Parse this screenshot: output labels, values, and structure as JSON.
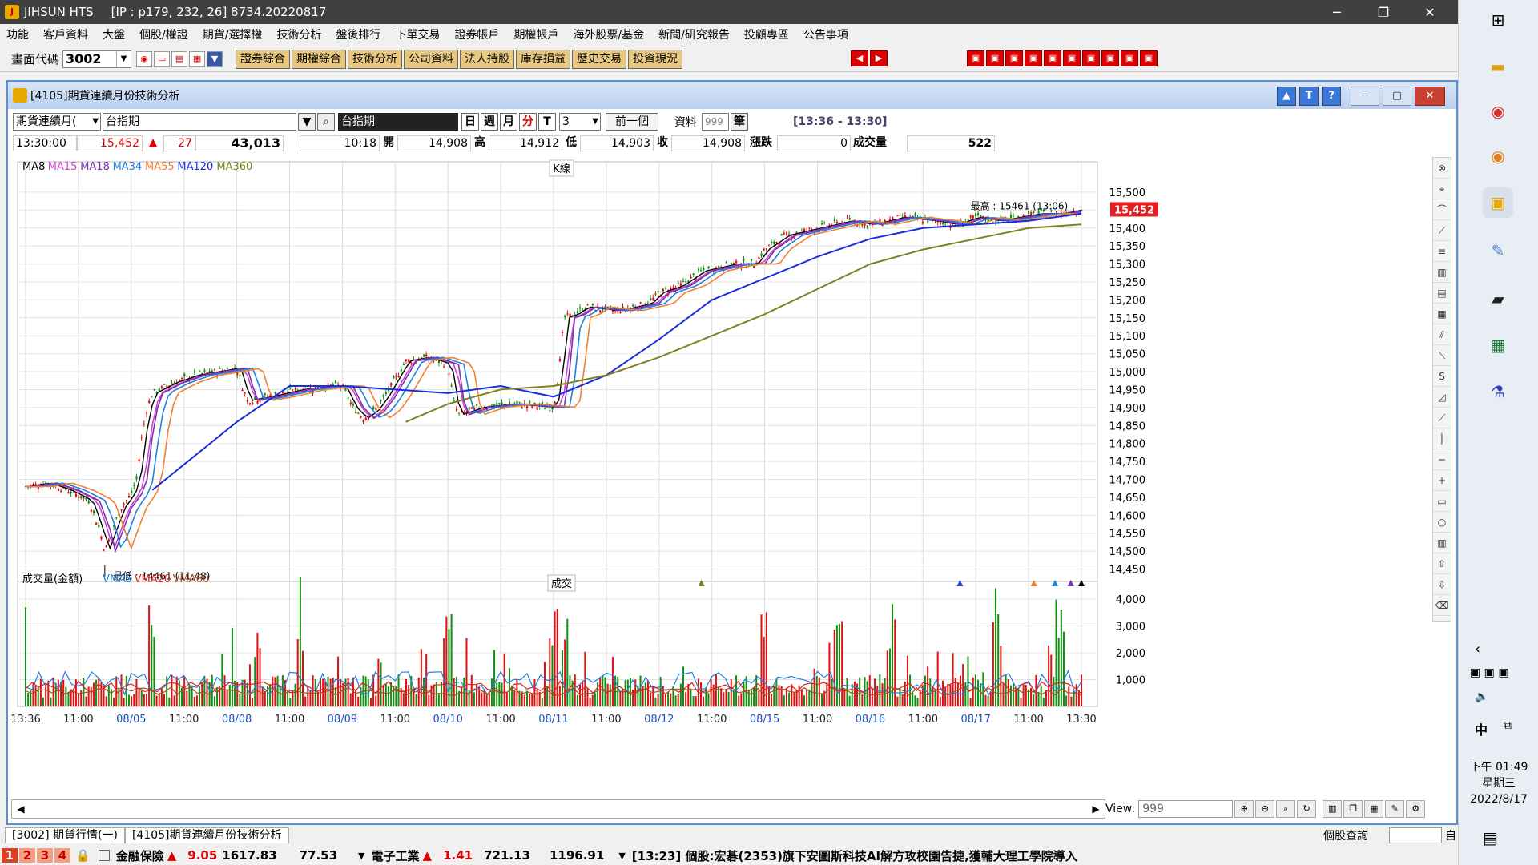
{
  "titlebar": {
    "app": "JIHSUN HTS",
    "info": "[IP : p179, 232, 26] 8734.20220817"
  },
  "menu": [
    "功能",
    "客戶資料",
    "大盤",
    "個股/權證",
    "期貨/選擇權",
    "技術分析",
    "盤後排行",
    "下單交易",
    "證券帳戶",
    "期權帳戶",
    "海外股票/基金",
    "新聞/研究報告",
    "投顧專區",
    "公告事項"
  ],
  "toolbar": {
    "code_label": "畫面代碼",
    "code_value": "3002",
    "buttons": [
      "證券綜合",
      "期權綜合",
      "技術分析",
      "公司資料",
      "法人持股",
      "庫存損益",
      "歷史交易",
      "投資現況"
    ]
  },
  "window": {
    "title": "[4105]期貨連續月份技術分析"
  },
  "controls": {
    "contract_select": "期貨連續月(",
    "index_select": "台指期",
    "name_box": "台指期",
    "periods": [
      "日",
      "週",
      "月",
      "分",
      "T"
    ],
    "minutes": "3",
    "prev_label": "前一個",
    "data_label": "資料",
    "data_value": "999",
    "unit_label": "筆",
    "time_range": "[13:36 - 13:30]"
  },
  "quote": {
    "time": "13:30:00",
    "price": "15,452",
    "change": "27",
    "volume_total": "43,013",
    "time2": "10:18",
    "open_label": "開",
    "open": "14,908",
    "high_label": "高",
    "high": "14,912",
    "low_label": "低",
    "low": "14,903",
    "close_label": "收",
    "close": "14,908",
    "chg_label": "漲跌",
    "chg": "0",
    "vol_label": "成交量",
    "vol": "522"
  },
  "legend_price": [
    {
      "name": "MA8",
      "color": "#000000"
    },
    {
      "name": "MA15",
      "color": "#cc44cc"
    },
    {
      "name": "MA18",
      "color": "#7a30b0"
    },
    {
      "name": "MA34",
      "color": "#2080e0"
    },
    {
      "name": "MA55",
      "color": "#f08030"
    },
    {
      "name": "MA120",
      "color": "#1a2ce0"
    },
    {
      "name": "MA360",
      "color": "#808020"
    }
  ],
  "kline_label": "K線",
  "legend_volume": [
    {
      "name": "成交量(金額)",
      "color": "#000000"
    },
    {
      "name": "VMA5",
      "color": "#2080e0"
    },
    {
      "name": "VMA20",
      "color": "#e02020"
    },
    {
      "name": "VMA60",
      "color": "#a05020"
    }
  ],
  "volume_label": "成交",
  "high_annot": "最高 : 15461 (13:06)",
  "low_annot": "最低 : 14461 (11:48)",
  "last_price_tag": "15,452",
  "view_label": "View:",
  "view_value": "999",
  "tabs": [
    "[3002] 期貨行情(一)",
    "[4105]期貨連續月份技術分析"
  ],
  "stock_query": "個股查詢",
  "auto_label": "自",
  "ticker": {
    "nums": [
      "1",
      "2",
      "3",
      "4"
    ],
    "sec1": "金融保險",
    "sec1_chg": "9.05",
    "sec1_val": "1617.83",
    "sec1_amt": "77.53",
    "sec2": "電子工業",
    "sec2_chg": "1.41",
    "sec2_val": "721.13",
    "sec2_amt": "1196.91",
    "news": "[13:23] 個股:宏碁(2353)旗下安圖斯科技AI解方攻校園告捷,獲輔大理工學院導入"
  },
  "clock": {
    "time": "下午 01:49",
    "day": "星期三",
    "date": "2022/8/17"
  },
  "ime": "中",
  "chart_data": [
    {
      "type": "candlestick",
      "title": "",
      "x_labels": [
        "13:36",
        "11:00",
        "08/05",
        "11:00",
        "08/08",
        "11:00",
        "08/09",
        "11:00",
        "08/10",
        "11:00",
        "08/11",
        "11:00",
        "08/12",
        "11:00",
        "08/15",
        "11:00",
        "08/16",
        "11:00",
        "08/17",
        "11:00",
        "13:30"
      ],
      "y_ticks": [
        15500,
        15450,
        15400,
        15350,
        15300,
        15250,
        15200,
        15150,
        15100,
        15050,
        15000,
        14950,
        14900,
        14850,
        14800,
        14750,
        14700,
        14650,
        14600,
        14550,
        14500,
        14450
      ],
      "ylim": [
        14420,
        15540
      ],
      "close_path": [
        [
          0,
          14680
        ],
        [
          0.02,
          14690
        ],
        [
          0.04,
          14670
        ],
        [
          0.06,
          14640
        ],
        [
          0.07,
          14560
        ],
        [
          0.075,
          14500
        ],
        [
          0.08,
          14540
        ],
        [
          0.09,
          14620
        ],
        [
          0.1,
          14660
        ],
        [
          0.105,
          14700
        ],
        [
          0.11,
          14820
        ],
        [
          0.115,
          14900
        ],
        [
          0.12,
          14940
        ],
        [
          0.14,
          14970
        ],
        [
          0.16,
          14990
        ],
        [
          0.18,
          15000
        ],
        [
          0.2,
          15010
        ],
        [
          0.205,
          14960
        ],
        [
          0.21,
          14920
        ],
        [
          0.23,
          14930
        ],
        [
          0.26,
          14950
        ],
        [
          0.29,
          14960
        ],
        [
          0.3,
          14960
        ],
        [
          0.31,
          14900
        ],
        [
          0.32,
          14870
        ],
        [
          0.33,
          14890
        ],
        [
          0.34,
          14930
        ],
        [
          0.35,
          14980
        ],
        [
          0.36,
          15030
        ],
        [
          0.38,
          15040
        ],
        [
          0.4,
          15020
        ],
        [
          0.405,
          14920
        ],
        [
          0.41,
          14880
        ],
        [
          0.43,
          14900
        ],
        [
          0.46,
          14910
        ],
        [
          0.5,
          14900
        ],
        [
          0.505,
          15000
        ],
        [
          0.51,
          15150
        ],
        [
          0.52,
          15160
        ],
        [
          0.53,
          15180
        ],
        [
          0.56,
          15170
        ],
        [
          0.59,
          15190
        ],
        [
          0.6,
          15220
        ],
        [
          0.62,
          15240
        ],
        [
          0.64,
          15280
        ],
        [
          0.67,
          15300
        ],
        [
          0.69,
          15300
        ],
        [
          0.7,
          15340
        ],
        [
          0.72,
          15380
        ],
        [
          0.75,
          15400
        ],
        [
          0.78,
          15420
        ],
        [
          0.8,
          15410
        ],
        [
          0.83,
          15430
        ],
        [
          0.86,
          15420
        ],
        [
          0.88,
          15410
        ],
        [
          0.9,
          15430
        ],
        [
          0.92,
          15420
        ],
        [
          0.94,
          15430
        ],
        [
          0.96,
          15440
        ],
        [
          0.98,
          15440
        ],
        [
          1.0,
          15452
        ]
      ],
      "ma_series": {
        "MA120": [
          [
            0.12,
            14670
          ],
          [
            0.2,
            14860
          ],
          [
            0.25,
            14960
          ],
          [
            0.3,
            14960
          ],
          [
            0.35,
            14950
          ],
          [
            0.4,
            14940
          ],
          [
            0.45,
            14960
          ],
          [
            0.5,
            14930
          ],
          [
            0.55,
            14990
          ],
          [
            0.6,
            15090
          ],
          [
            0.65,
            15200
          ],
          [
            0.7,
            15260
          ],
          [
            0.75,
            15320
          ],
          [
            0.8,
            15370
          ],
          [
            0.85,
            15400
          ],
          [
            0.9,
            15410
          ],
          [
            0.95,
            15420
          ],
          [
            1.0,
            15440
          ]
        ],
        "MA360": [
          [
            0.36,
            14860
          ],
          [
            0.4,
            14910
          ],
          [
            0.45,
            14950
          ],
          [
            0.5,
            14960
          ],
          [
            0.55,
            14990
          ],
          [
            0.6,
            15040
          ],
          [
            0.65,
            15100
          ],
          [
            0.7,
            15160
          ],
          [
            0.75,
            15230
          ],
          [
            0.8,
            15300
          ],
          [
            0.85,
            15340
          ],
          [
            0.9,
            15370
          ],
          [
            0.95,
            15400
          ],
          [
            1.0,
            15410
          ]
        ]
      },
      "high": 15461,
      "low": 14461
    },
    {
      "type": "bar",
      "title": "",
      "series_names": [
        "成交量(金額)",
        "VMA5",
        "VMA20",
        "VMA60"
      ],
      "y_ticks": [
        4000,
        3000,
        2000,
        1000
      ],
      "ylim": [
        0,
        4300
      ]
    }
  ]
}
